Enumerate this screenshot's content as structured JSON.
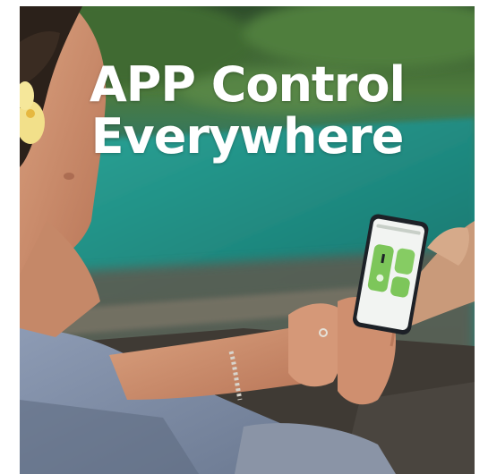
{
  "headline": {
    "line1": "APP Control",
    "line2": "Everywhere"
  },
  "colors": {
    "pool": "#1f8f86",
    "foliage": "#3f6b32",
    "app_accent": "#7dc65a",
    "shirt": "#7f8fa8",
    "text": "#ffffff"
  }
}
